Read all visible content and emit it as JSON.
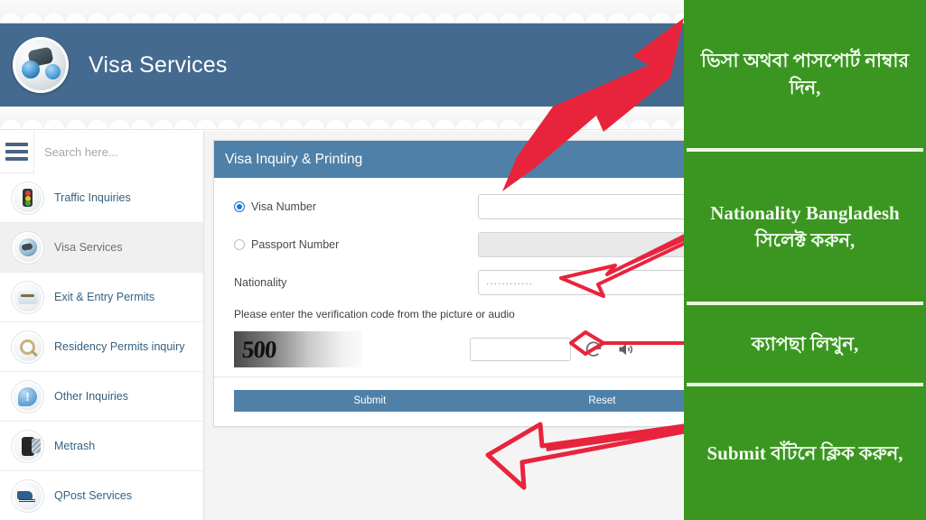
{
  "header": {
    "title": "Visa Services",
    "logo_icon": "visa-globe-logo"
  },
  "sidebar": {
    "menu_icon": "hamburger-menu-icon",
    "search": {
      "placeholder": "Search here...",
      "value": ""
    },
    "items": [
      {
        "label": "Traffic Inquiries",
        "icon": "traffic-light-icon",
        "active": false
      },
      {
        "label": "Visa Services",
        "icon": "globe-visa-icon",
        "active": true
      },
      {
        "label": "Exit & Entry Permits",
        "icon": "passport-stamp-icon",
        "active": false
      },
      {
        "label": "Residency Permits inquiry",
        "icon": "magnifier-icon",
        "active": false
      },
      {
        "label": "Other Inquiries",
        "icon": "info-bubble-icon",
        "active": false
      },
      {
        "label": "Metrash",
        "icon": "mobile-phone-icon",
        "active": false
      },
      {
        "label": "QPost Services",
        "icon": "delivery-truck-icon",
        "active": false
      }
    ]
  },
  "card": {
    "title": "Visa Inquiry & Printing",
    "collapse_icon": "minus-collapse-icon",
    "fields": {
      "visa_number": {
        "label": "Visa Number",
        "value": "",
        "selected": true
      },
      "passport_number": {
        "label": "Passport Number",
        "value": "",
        "selected": false,
        "disabled": true
      },
      "nationality": {
        "label": "Nationality",
        "value": "............"
      }
    },
    "captcha": {
      "hint": "Please enter the verification code from the picture or audio",
      "image_text": "500",
      "input_value": "",
      "refresh_icon": "refresh-icon",
      "audio_icon": "speaker-audio-icon"
    },
    "buttons": {
      "submit": "Submit",
      "reset": "Reset"
    }
  },
  "instructions": {
    "panel_color": "#3a9620",
    "steps": [
      {
        "text": "ভিসা অথবা পাসপোর্ট নাম্বার দিন,"
      },
      {
        "text": "Nationality Bangladesh সিলেক্ট করুন,"
      },
      {
        "text": "ক্যাপছা লিখুন,"
      },
      {
        "text": "Submit বাঁটনে ক্লিক করুন,"
      }
    ]
  },
  "annotations": {
    "arrow_color": "#e8243c",
    "arrows": [
      {
        "name": "arrow-to-visa-number-field"
      },
      {
        "name": "arrow-to-nationality-field"
      },
      {
        "name": "arrow-to-captcha-input"
      },
      {
        "name": "arrow-to-submit-button"
      }
    ]
  }
}
